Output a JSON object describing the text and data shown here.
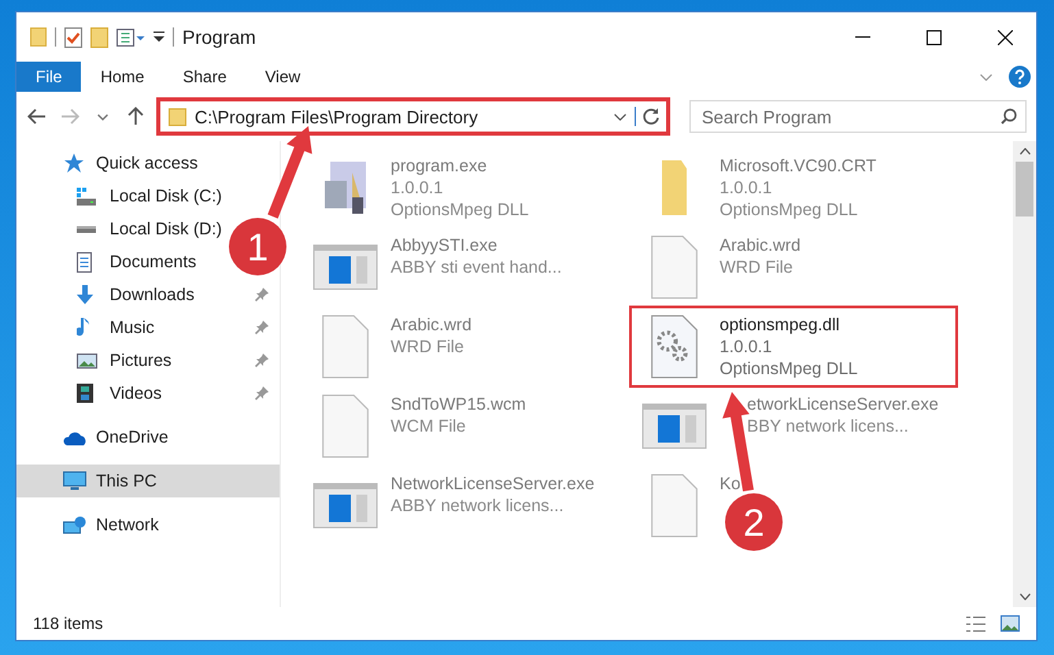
{
  "window": {
    "title": "Program"
  },
  "ribbon_tabs": [
    {
      "label": "File",
      "kind": "file"
    },
    {
      "label": "Home",
      "kind": "tab"
    },
    {
      "label": "Share",
      "kind": "tab"
    },
    {
      "label": "View",
      "kind": "tab"
    }
  ],
  "address_bar": {
    "path": "C:\\Program Files\\Program Directory",
    "highlighted": true
  },
  "search": {
    "placeholder": "Search Program"
  },
  "navigation": [
    {
      "label": "Quick access",
      "kind": "star",
      "selected": false,
      "children": [
        {
          "label": "Local Disk (C:)",
          "kind": "systemdrive",
          "selected": false,
          "pinned": false
        },
        {
          "label": "Local Disk (D:)",
          "kind": "drive",
          "selected": false,
          "pinned": false
        },
        {
          "label": "Documents",
          "kind": "document",
          "selected": false,
          "pinned": false
        },
        {
          "label": "Downloads",
          "kind": "download",
          "selected": false,
          "pinned": true
        },
        {
          "label": "Music",
          "kind": "music",
          "selected": false,
          "pinned": true
        },
        {
          "label": "Pictures",
          "kind": "pictures",
          "selected": false,
          "pinned": true
        },
        {
          "label": "Videos",
          "kind": "videos",
          "selected": false,
          "pinned": true
        }
      ]
    },
    {
      "label": "OneDrive",
      "kind": "cloud",
      "selected": false
    },
    {
      "label": "This PC",
      "kind": "computer",
      "selected": true
    },
    {
      "label": "Network",
      "kind": "network",
      "selected": false
    }
  ],
  "files": [
    {
      "name": "program.exe",
      "details": [
        "1.0.0.1",
        "OptionsMpeg DLL"
      ],
      "kind": "app",
      "dimmed": true,
      "highlighted": false
    },
    {
      "name": "Microsoft.VC90.CRT",
      "details": [
        "1.0.0.1",
        "OptionsMpeg DLL"
      ],
      "kind": "folder",
      "dimmed": true,
      "highlighted": false
    },
    {
      "name": "AbbyySTI.exe",
      "details": [
        "ABBY sti event hand..."
      ],
      "kind": "window",
      "dimmed": true,
      "highlighted": false
    },
    {
      "name": "Arabic.wrd",
      "details": [
        "WRD File"
      ],
      "kind": "file",
      "dimmed": true,
      "highlighted": false
    },
    {
      "name": "Arabic.wrd",
      "details": [
        "WRD File"
      ],
      "kind": "file",
      "dimmed": true,
      "highlighted": false
    },
    {
      "name": "optionsmpeg.dll",
      "details": [
        "1.0.0.1",
        "OptionsMpeg DLL"
      ],
      "kind": "dll",
      "dimmed": false,
      "highlighted": true
    },
    {
      "name": "SndToWP15.wcm",
      "details": [
        "WCM File"
      ],
      "kind": "file",
      "dimmed": true,
      "highlighted": false
    },
    {
      "name": "etworkLicenseServer.exe",
      "details": [
        "BBY network licens..."
      ],
      "kind": "window",
      "dimmed": true,
      "highlighted": false
    },
    {
      "name": "NetworkLicenseServer.exe",
      "details": [
        "ABBY network licens..."
      ],
      "kind": "window",
      "dimmed": true,
      "highlighted": false
    },
    {
      "name": "Ko",
      "kind": "file",
      "dimmed": true,
      "highlighted": false
    }
  ],
  "status_bar": {
    "item_count": "118 items"
  },
  "annotations": [
    {
      "label": "1"
    },
    {
      "label": "2"
    }
  ]
}
